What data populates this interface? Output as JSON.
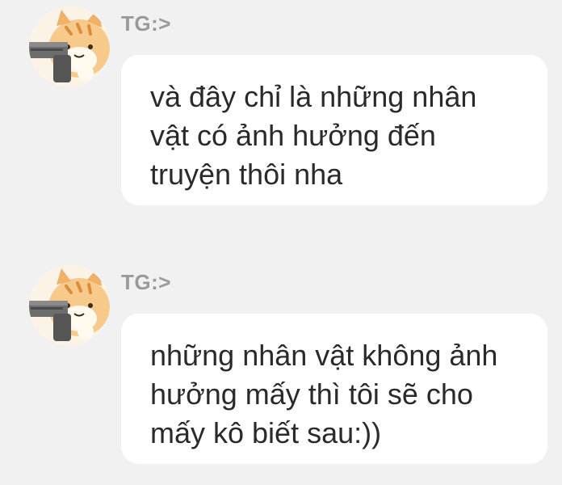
{
  "messages": [
    {
      "sender": "TG:>",
      "avatar_icon": "cat-with-gun-avatar-icon",
      "lines": [
        "và đây chỉ là những nhân",
        "vật có ảnh hưởng đến",
        "truyện thôi nha"
      ]
    },
    {
      "sender": "TG:>",
      "avatar_icon": "cat-with-gun-avatar-icon",
      "lines": [
        "những nhân vật không ảnh",
        "hưởng mấy thì tôi sẽ cho",
        "mấy kô biết sau:))"
      ]
    }
  ],
  "colors": {
    "background": "#f1f1f1",
    "bubble": "#ffffff",
    "sender_text": "#9a9a9a",
    "message_text": "#2a2a2a"
  }
}
